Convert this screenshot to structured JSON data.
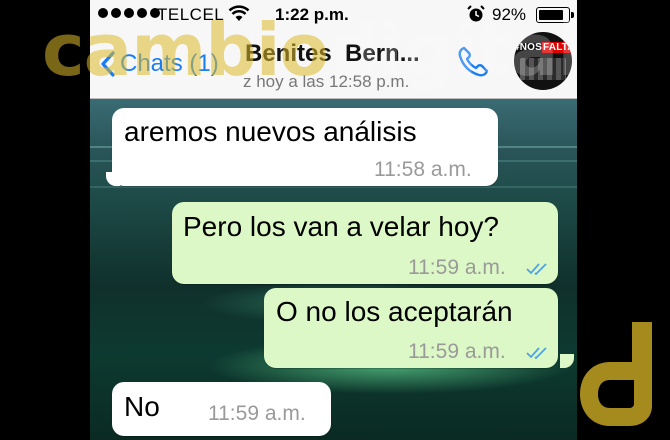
{
  "status_bar": {
    "carrier": "TELCEL",
    "time": "1:22 p.m.",
    "battery": "92%",
    "battery_level": 0.92
  },
  "nav": {
    "back_label": "Chats (1)",
    "contact_name": "Benites  Bern...",
    "subtitle": "z hoy a las 12:58 p.m.",
    "avatar_text_prefix": "#NOS",
    "avatar_text_highlight": "FALTAN"
  },
  "messages": [
    {
      "direction": "incoming",
      "text": "aremos nuevos análisis",
      "time": "11:58 a.m."
    },
    {
      "direction": "outgoing",
      "text": "Pero los van a velar hoy?",
      "time": "11:59 a.m.",
      "status": "delivered"
    },
    {
      "direction": "outgoing",
      "text": "O no los aceptarán",
      "time": "11:59 a.m.",
      "status": "delivered"
    },
    {
      "direction": "incoming",
      "text": "No",
      "time": "11:59 a.m."
    }
  ],
  "watermark": {
    "part1": "cambio",
    "part2": "digital"
  },
  "colors": {
    "ios_blue": "#1a7ef2",
    "outgoing_bubble": "#dcf8c6",
    "incoming_bubble": "#ffffff",
    "read_tick": "#4fa3e0",
    "watermark_gold": "#dcb928"
  },
  "icons": [
    "wifi-icon",
    "alarm-icon",
    "battery-icon",
    "back-chevron-icon",
    "phone-call-icon",
    "double-check-icon",
    "cambio-digital-logo"
  ]
}
